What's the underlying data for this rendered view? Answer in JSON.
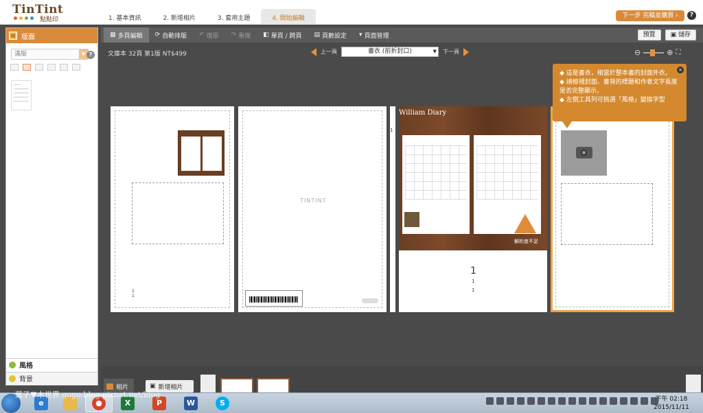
{
  "header": {
    "logo": "TinTint",
    "logo_sub": "點點印",
    "steps": [
      "1. 基本資訊",
      "2. 新增相片",
      "3. 套用主題",
      "4. 開始編輯"
    ],
    "next_button": "下一步 完稿並購買 ›",
    "help": "?"
  },
  "left_panel": {
    "tab_active": "版面",
    "select_value": "滿版",
    "help": "?",
    "tabs": [
      "風格",
      "背景"
    ]
  },
  "toolbar": {
    "items": [
      "多頁編輯",
      "自動排版",
      "復原",
      "重做",
      "單頁 / 跨頁",
      "頁數設定",
      "頁面管理"
    ],
    "preview": "預覽",
    "save": "儲存"
  },
  "work": {
    "info": "文庫本 32頁 第1版 NT$499",
    "prev": "上一頁",
    "next": "下一頁",
    "page_select": "書衣 (前折封口)",
    "zoom_minus": "⊖",
    "zoom_plus": "⊕",
    "cover_title": "William Diary",
    "warning_text": "解析度不足",
    "spine_num": "1",
    "page_nums": [
      "1",
      "1",
      "1"
    ],
    "left_page_nums": [
      "1",
      "1"
    ],
    "tintint_mark": "TINTINT",
    "tooltip": [
      "◆ 這是書衣，相當於整本書的封面外衣。",
      "◆ 請檢視封面、書背的標題和作者文字長度是否完整顯示。",
      "◆ 左側工具列可挑選「風格」變換字型"
    ]
  },
  "bottom": {
    "photos": "相片",
    "add_photo": "新增相片"
  },
  "taskbar": {
    "time": "下午 02:18",
    "date": "2015/11/11",
    "watermark": "葉子♥木世界 gogo-blog.pixnet.net/blog"
  },
  "colors": {
    "accent": "#d98a3a",
    "toolbar": "#5a5a5a",
    "workspace": "#4a4a4a",
    "cover_wood": "#6b3f24"
  }
}
